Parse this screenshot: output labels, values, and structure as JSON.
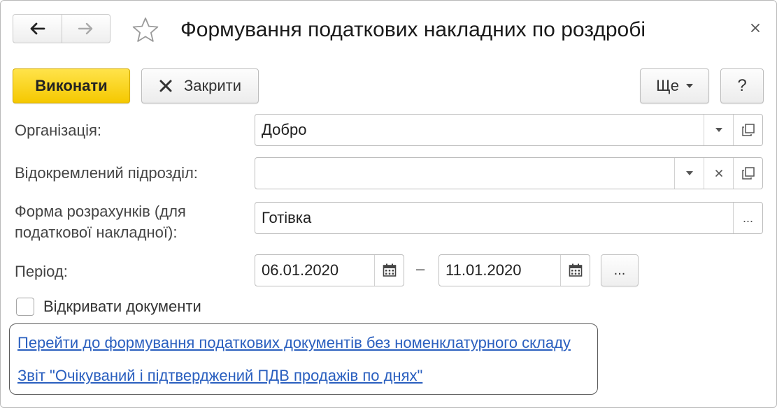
{
  "header": {
    "title": "Формування податкових накладних по роздробі",
    "back_icon": "arrow-left-icon",
    "forward_icon": "arrow-right-icon",
    "favorite_icon": "star-outline-icon",
    "close_icon": "close-icon"
  },
  "toolbar": {
    "execute_label": "Виконати",
    "close_label": "Закрити",
    "more_label": "Ще",
    "help_label": "?"
  },
  "form": {
    "organization": {
      "label": "Організація:",
      "value": "Добро"
    },
    "subdivision": {
      "label": "Відокремлений підрозділ:",
      "value": ""
    },
    "payment_form": {
      "label_line1": "Форма розрахунків (для",
      "label_line2": "податкової накладної):",
      "value": "Готівка",
      "select_label": "..."
    },
    "period": {
      "label": "Період:",
      "start": "06.01.2020",
      "end": "11.01.2020",
      "separator": "–",
      "more_label": "..."
    },
    "open_documents": {
      "label": "Відкривати документи",
      "checked": false
    }
  },
  "links": [
    "Перейти до формування податкових документів без номенклатурного складу",
    "Звіт \"Очікуваний і підтверджений ПДВ продажів по днях\""
  ],
  "colors": {
    "primary_button": "#f5c800",
    "link": "#2a5fbf",
    "border": "#bdbdbd"
  }
}
